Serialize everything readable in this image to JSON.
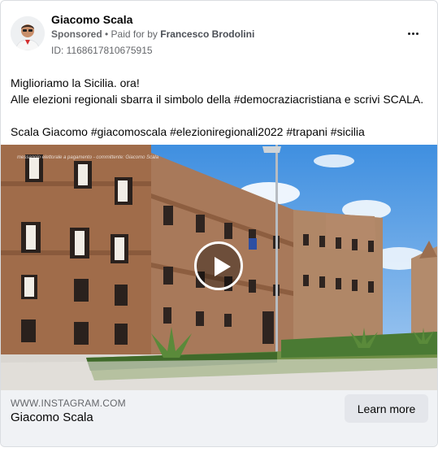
{
  "post": {
    "author": "Giacomo Scala",
    "sponsored_label": "Sponsored",
    "separator": " • ",
    "paid_prefix": "Paid for by ",
    "payer": "Francesco Brodolini",
    "ad_id": "ID: 1168617810675915",
    "more_icon": "more-horizontal-icon",
    "text_lines": [
      "Miglioriamo la Sicilia. ora!",
      "Alle elezioni regionali sbarra il simbolo della #democraziacristiana e scrivi SCALA.",
      "Scala Giacomo #giacomoscala #elezioniregionali2022 #trapani #sicilia"
    ]
  },
  "media": {
    "watermark": "messaggio elettorale a pagamento - committente: Giacomo Scala",
    "play_icon": "play-icon"
  },
  "footer": {
    "domain": "WWW.INSTAGRAM.COM",
    "title": "Giacomo Scala",
    "cta_label": "Learn more"
  }
}
